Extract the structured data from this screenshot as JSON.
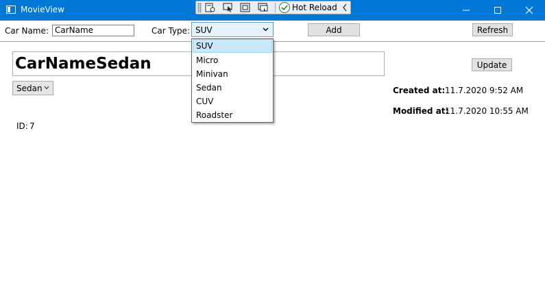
{
  "window": {
    "title": "MovieView",
    "controls": [
      "minimize-icon",
      "maximize-icon",
      "close-icon"
    ],
    "accent": "#0078d7"
  },
  "hot_reload_toolbar": {
    "tools": [
      "live-visual-tree-icon",
      "select-element-icon",
      "display-layout-adorners-icon",
      "track-focused-element-icon"
    ],
    "status_label": "Hot Reload",
    "status_icon": "check-circle-icon"
  },
  "form": {
    "car_name_label": "Car Name:",
    "car_name_value": "CarName",
    "car_type_label": "Car Type:",
    "car_type_selected": "SUV",
    "add_label": "Add",
    "refresh_label": "Refresh"
  },
  "car_type_options": [
    "SUV",
    "Micro",
    "Minivan",
    "Sedan",
    "CUV",
    "Roadster"
  ],
  "details": {
    "name": "CarNameSedan",
    "type_selected": "Sedan",
    "update_label": "Update",
    "created_label": "Created at:",
    "created_value": "11.7.2020 9:52 AM",
    "modified_label": "Modified at:",
    "modified_value": "11.7.2020 10:55 AM",
    "id_label": "ID:",
    "id_value": "7"
  }
}
